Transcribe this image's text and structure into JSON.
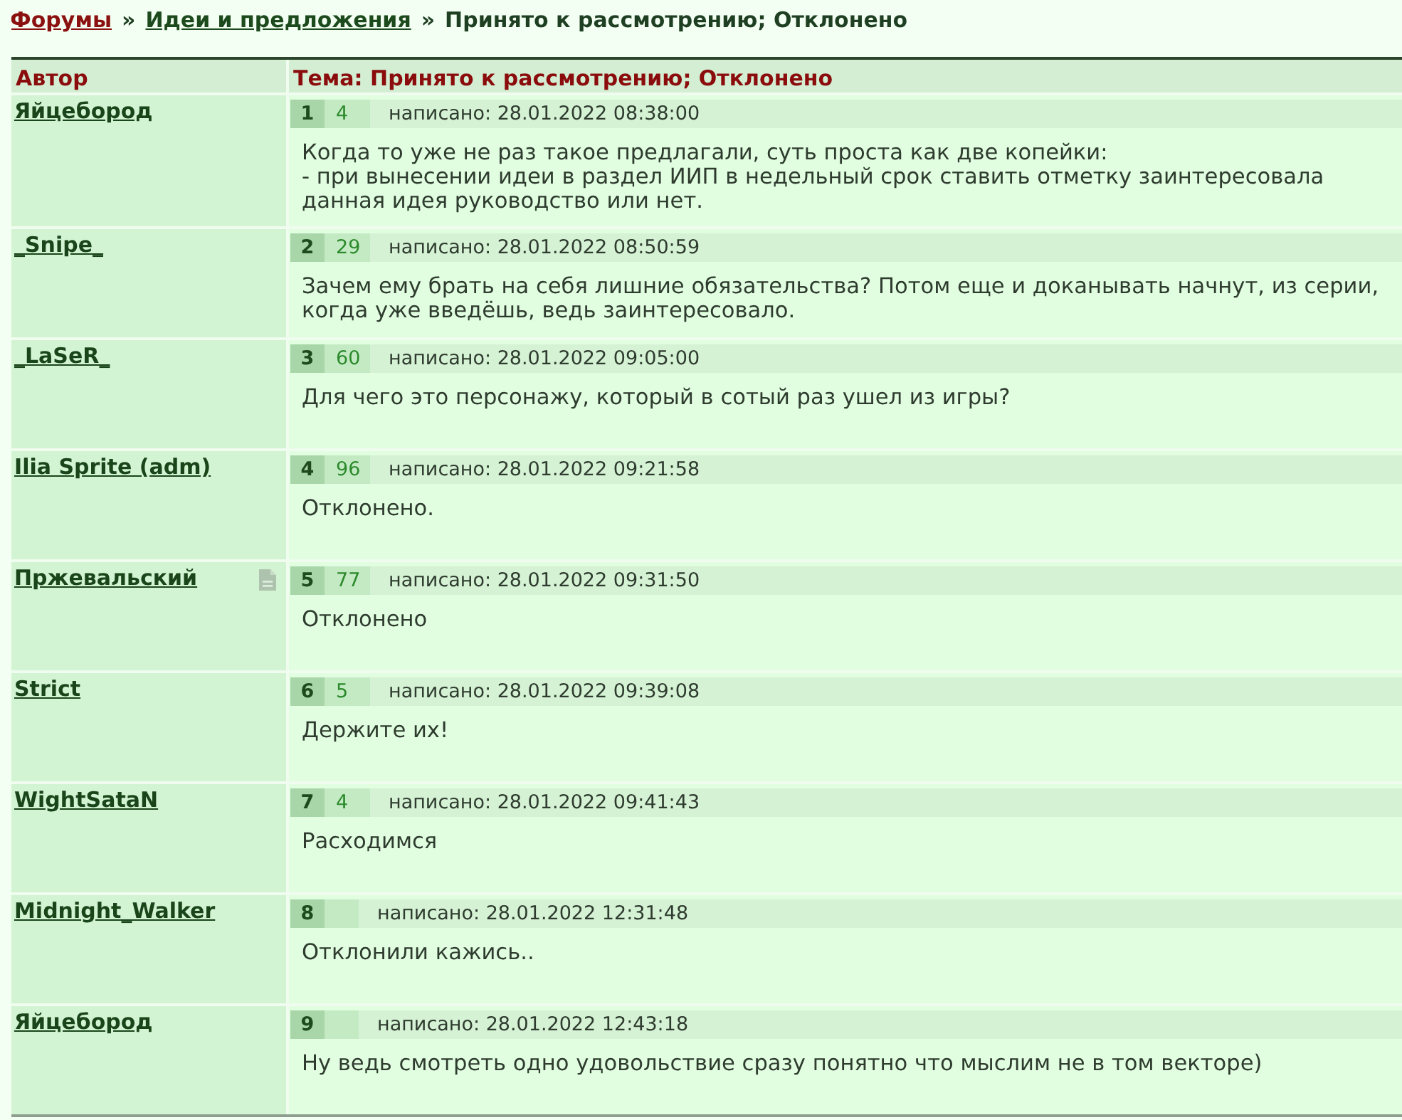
{
  "breadcrumb": {
    "items": [
      {
        "kind": "link",
        "text": "Форумы",
        "visited": true
      },
      {
        "kind": "separator",
        "text": "»"
      },
      {
        "kind": "link",
        "text": "Идеи и предложения",
        "visited": false
      },
      {
        "kind": "separator",
        "text": "»"
      },
      {
        "kind": "current",
        "text": "Принято к рассмотрению; Отклонено"
      }
    ]
  },
  "table": {
    "columns": [
      "Автор",
      "Тема: Принято к рассмотрению; Отклонено"
    ],
    "posts": [
      {
        "author": "Яйцебород",
        "note_icon": false,
        "number": "1",
        "count": "4",
        "date": "написано: 28.01.2022 08:38:00",
        "lines": [
          "Когда то уже не раз такое предлагали, суть проста как две копейки:",
          "- при вынесении идеи в раздел ИИП в недельный срок ставить отметку заинтересовала",
          "данная идея руководство или нет."
        ]
      },
      {
        "author": "_Snipe_",
        "note_icon": false,
        "number": "2",
        "count": "29",
        "date": "написано: 28.01.2022 08:50:59",
        "lines": [
          "Зачем ему брать на себя лишние обязательства? Потом еще и доканывать начнут, из серии,",
          "когда уже введёшь, ведь заинтересовало."
        ]
      },
      {
        "author": "_LaSeR_",
        "note_icon": false,
        "number": "3",
        "count": "60",
        "date": "написано: 28.01.2022 09:05:00",
        "lines": [
          "Для чего это персонажу, который в сотый раз ушел из игры?"
        ]
      },
      {
        "author": "Ilia Sprite (adm)",
        "note_icon": false,
        "number": "4",
        "count": "96",
        "date": "написано: 28.01.2022 09:21:58",
        "lines": [
          "Отклонено."
        ]
      },
      {
        "author": "Пржевальский",
        "note_icon": true,
        "number": "5",
        "count": "77",
        "date": "написано: 28.01.2022 09:31:50",
        "lines": [
          "Отклонено"
        ]
      },
      {
        "author": "Strict",
        "note_icon": false,
        "number": "6",
        "count": "5",
        "date": "написано: 28.01.2022 09:39:08",
        "lines": [
          "Держите их!"
        ]
      },
      {
        "author": "WightSataN",
        "note_icon": false,
        "number": "7",
        "count": "4",
        "date": "написано: 28.01.2022 09:41:43",
        "lines": [
          "Расходимся"
        ]
      },
      {
        "author": "Midnight_Walker",
        "note_icon": false,
        "number": "8",
        "date": "написано: 28.01.2022 12:31:48",
        "lines": [
          "Отклонили кажись.."
        ]
      },
      {
        "author": "Яйцебород",
        "note_icon": false,
        "number": "9",
        "date": "написано: 28.01.2022 12:43:18",
        "lines": [
          "Ну ведь смотреть одно удовольствие сразу понятно что мыслим не в том векторе)"
        ]
      }
    ]
  }
}
